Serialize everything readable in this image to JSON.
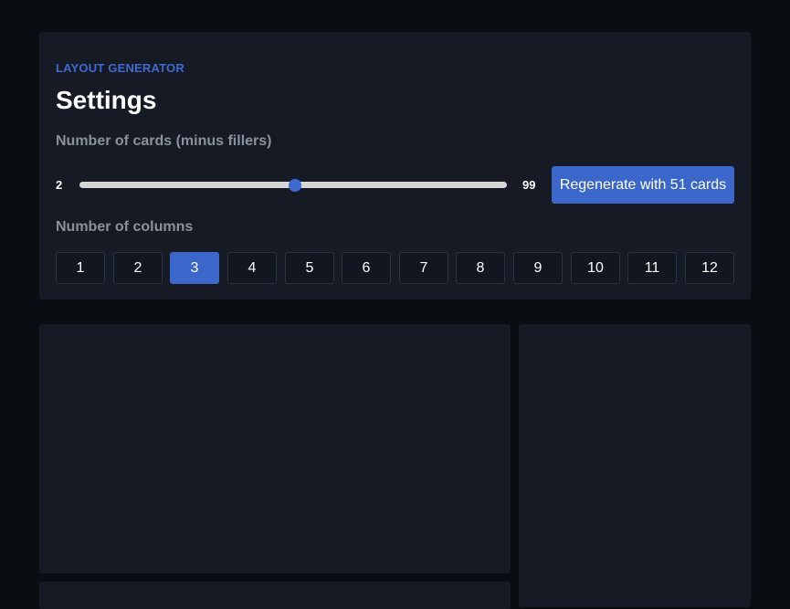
{
  "settings": {
    "eyebrow": "LAYOUT GENERATOR",
    "title": "Settings",
    "cards_label": "Number of cards (minus fillers)",
    "cards_slider": {
      "min": 2,
      "max": 99,
      "value": 51,
      "min_label": "2",
      "max_label": "99"
    },
    "regenerate_label": "Regenerate with 51 cards",
    "columns_label": "Number of columns",
    "columns": [
      "1",
      "2",
      "3",
      "4",
      "5",
      "6",
      "7",
      "8",
      "9",
      "10",
      "11",
      "12"
    ],
    "selected_column": "3"
  },
  "colors": {
    "accent": "#3a67c9",
    "background": "#0a0d12",
    "panel": "#151a25"
  }
}
